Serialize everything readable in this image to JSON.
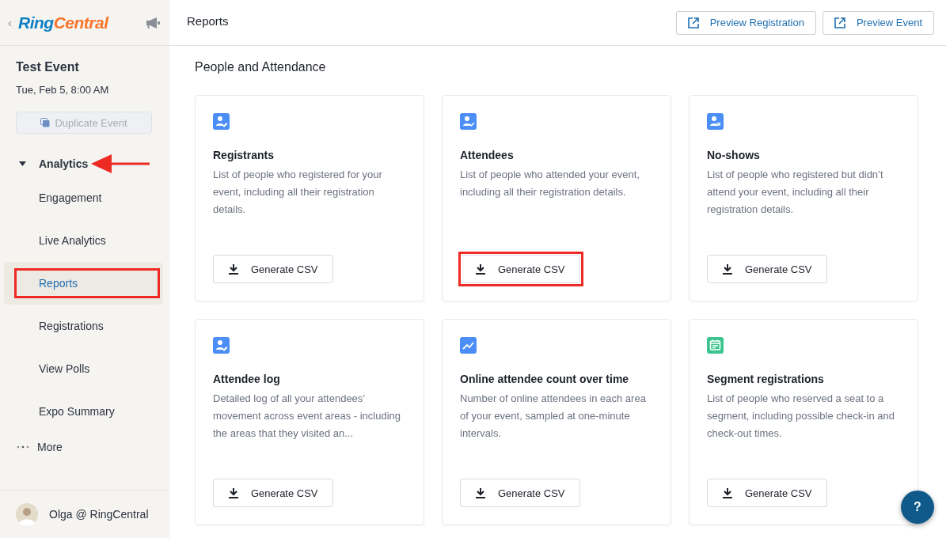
{
  "sidebar": {
    "back": "‹",
    "logo": {
      "part_1": "Ring",
      "part_2": "Central"
    },
    "event_title": "Test Event",
    "event_date": "Tue, Feb 5, 8:00 AM",
    "duplicate_button": {
      "label": "Duplicate Event",
      "disabled": true
    },
    "section": {
      "label": "Analytics",
      "expanded": true,
      "arrow_annotation": true
    },
    "items": [
      {
        "label": "Engagement",
        "selected": false,
        "highlighted": false
      },
      {
        "label": "Live Analytics",
        "selected": false,
        "highlighted": false
      },
      {
        "label": "Reports",
        "selected": true,
        "highlighted": true
      },
      {
        "label": "Registrations",
        "selected": false,
        "highlighted": false
      },
      {
        "label": "View Polls",
        "selected": false,
        "highlighted": false
      },
      {
        "label": "Expo Summary",
        "selected": false,
        "highlighted": false
      }
    ],
    "more": "More",
    "user": "Olga @ RingCentral"
  },
  "header": {
    "title": "Reports",
    "buttons": [
      "Preview Registration",
      "Preview Event"
    ]
  },
  "section_title": "People and Attendance",
  "cards": [
    {
      "kind": "person-edit",
      "color": "#4b8ef5",
      "title": "Registrants",
      "description": "List of people who registered for your event, including all their registration details.",
      "button": "Generate CSV",
      "highlighted": false
    },
    {
      "kind": "person-check",
      "color": "#4b8ef5",
      "title": "Attendees",
      "description": "List of people who attended your event, including all their registration details.",
      "button": "Generate CSV",
      "highlighted": true
    },
    {
      "kind": "person-x",
      "color": "#4b8ef5",
      "title": "No-shows",
      "description": "List of people who registered but didn’t attend your event, including all their registration details.",
      "button": "Generate CSV",
      "highlighted": false
    },
    {
      "kind": "person-edit",
      "color": "#4b8ef5",
      "title": "Attendee log",
      "description": "Detailed log of all your attendees’ movement across event areas - including the areas that they visited an...",
      "button": "Generate CSV",
      "highlighted": false
    },
    {
      "kind": "chart",
      "color": "#4b8ef5",
      "title": "Online attendee count over time",
      "description": "Number of online attendees in each area of your event, sampled at one-minute intervals.",
      "button": "Generate CSV",
      "highlighted": false
    },
    {
      "kind": "calendar",
      "color": "#3cc48f",
      "title": "Segment registrations",
      "description": "List of people who reserved a seat to a segment, including possible check-in and check-out times.",
      "button": "Generate CSV",
      "highlighted": false
    }
  ],
  "help_button": "?"
}
